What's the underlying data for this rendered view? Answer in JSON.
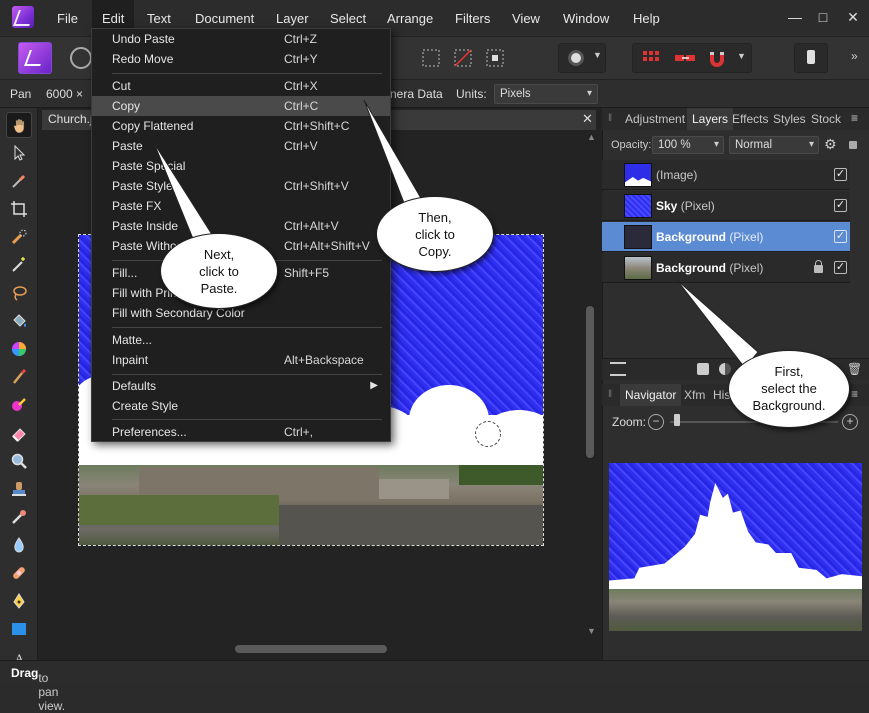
{
  "menubar": {
    "items": [
      "File",
      "Edit",
      "Text",
      "Document",
      "Layer",
      "Select",
      "Arrange",
      "Filters",
      "View",
      "Window",
      "Help"
    ],
    "window_controls": [
      "—",
      "□",
      "✕"
    ]
  },
  "context_bar": {
    "tool_name": "Pan",
    "size_text": "6000 ×",
    "camera_data": "nera Data",
    "units_label": "Units:",
    "units_value": "Pixels"
  },
  "document": {
    "tab_title": "Church.jp",
    "close_glyph": "✕"
  },
  "edit_menu": {
    "groups": [
      [
        {
          "label": "Undo Paste",
          "shortcut": "Ctrl+Z"
        },
        {
          "label": "Redo Move",
          "shortcut": "Ctrl+Y"
        }
      ],
      [
        {
          "label": "Cut",
          "shortcut": "Ctrl+X"
        },
        {
          "label": "Copy",
          "shortcut": "Ctrl+C"
        },
        {
          "label": "Copy Flattened",
          "shortcut": "Ctrl+Shift+C"
        },
        {
          "label": "Paste",
          "shortcut": "Ctrl+V"
        },
        {
          "label": "Paste Special",
          "shortcut": ""
        },
        {
          "label": "Paste Style",
          "shortcut": "Ctrl+Shift+V"
        },
        {
          "label": "Paste FX",
          "shortcut": ""
        },
        {
          "label": "Paste Inside",
          "shortcut": "Ctrl+Alt+V"
        },
        {
          "label": "Paste Without Format",
          "shortcut": "Ctrl+Alt+Shift+V"
        }
      ],
      [
        {
          "label": "Fill...",
          "shortcut": "Shift+F5"
        },
        {
          "label": "Fill with Primary Color",
          "shortcut": ""
        },
        {
          "label": "Fill with Secondary Color",
          "shortcut": ""
        }
      ],
      [
        {
          "label": "Matte...",
          "shortcut": ""
        },
        {
          "label": "Inpaint",
          "shortcut": "Alt+Backspace"
        }
      ],
      [
        {
          "label": "Defaults",
          "shortcut": "",
          "submenu": true
        },
        {
          "label": "Create Style",
          "shortcut": ""
        }
      ],
      [
        {
          "label": "Preferences...",
          "shortcut": "Ctrl+,"
        }
      ]
    ],
    "highlighted": "Copy"
  },
  "layers_panel": {
    "tabs": [
      "Adjustment",
      "Layers",
      "Effects",
      "Styles",
      "Stock"
    ],
    "active_tab": "Layers",
    "opacity_label": "Opacity:",
    "opacity_value": "100 %",
    "blend_mode": "Normal",
    "layers": [
      {
        "name": "",
        "type": "(Image)",
        "selected": false,
        "locked": false
      },
      {
        "name": "Sky",
        "type": "(Pixel)",
        "selected": false,
        "locked": false
      },
      {
        "name": "Background",
        "type": "(Pixel)",
        "selected": true,
        "locked": false
      },
      {
        "name": "Background",
        "type": "(Pixel)",
        "selected": false,
        "locked": true
      }
    ]
  },
  "navigator_panel": {
    "tabs": [
      "Navigator",
      "Xfm",
      "His"
    ],
    "active_tab": "Navigator",
    "zoom_label": "Zoom:"
  },
  "status_bar": {
    "bold": "Drag",
    "text": " to pan view."
  },
  "callouts": {
    "first": [
      "First,",
      "select the",
      "Background."
    ],
    "then": [
      "Then,",
      "click to",
      "Copy."
    ],
    "next": [
      "Next,",
      "click to",
      "Paste."
    ]
  },
  "colors": {
    "accent_selected": "#5b8bd2",
    "sky_blue": "#2f2ff0",
    "menu_bg": "#1f1f1f"
  }
}
